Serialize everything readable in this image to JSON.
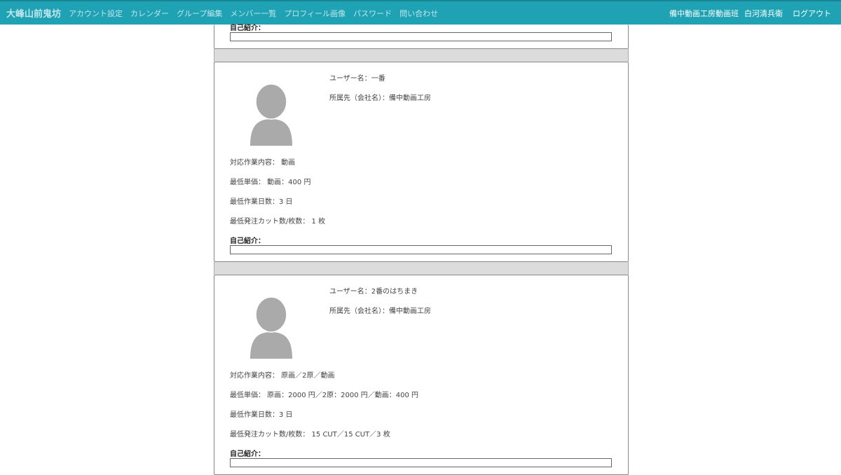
{
  "nav": {
    "brand": "大峰山前鬼坊",
    "items": [
      "アカウント設定",
      "カレンダー",
      "グループ編集",
      "メンバー一覧",
      "プロフィール画像",
      "パスワード",
      "問い合わせ"
    ],
    "company": "備中動画工房動画班",
    "user": "白河清兵衛",
    "logout": "ログアウト"
  },
  "intro_label": "自己紹介：",
  "members": [
    {
      "username": "ユーザー名：一番",
      "company": "所属先（会社名）：備中動画工房",
      "work": "対応作業内容： 動画",
      "price": "最低単価： 動画：400 円",
      "days": "最低作業日数：3 日",
      "cuts": "最低発注カット数/枚数： 1 枚"
    },
    {
      "username": "ユーザー名：2番のはちまき",
      "company": "所属先（会社名）：備中動画工房",
      "work": "対応作業内容： 原画／2原／動画",
      "price": "最低単価： 原画：2000 円／2原：2000 円／動画：400 円",
      "days": "最低作業日数：3 日",
      "cuts": "最低発注カット数/枚数： 15 CUT／15 CUT／3 枚"
    }
  ]
}
